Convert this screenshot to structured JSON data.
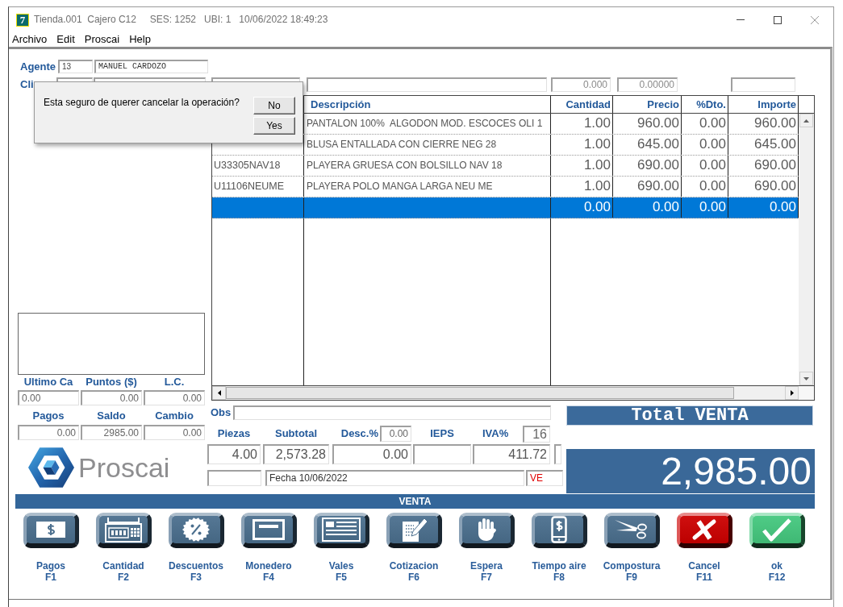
{
  "window": {
    "icon_glyph": "7",
    "title": "Tienda.001  Cajero C12     SES: 1252   UBI: 1   10/06/2022 18:49:23",
    "menu": [
      "Archivo",
      "Edit",
      "Proscai",
      "Help"
    ]
  },
  "agent": {
    "label": "Agente",
    "code": "13",
    "name": "MANUEL CARDOZO"
  },
  "client": {
    "label": "Cli",
    "value_1": "0.000",
    "value_2": "0.00000"
  },
  "table": {
    "columns": [
      "Descripción",
      "Cantidad",
      "Precio",
      "%Dto.",
      "Importe"
    ],
    "rows": [
      {
        "description": "PANTALON 100%  ALGODON MOD. ESCOCES OLI 1",
        "quantity": "1.00",
        "price": "960.00",
        "discount": "0.00",
        "amount": "960.00",
        "selected": false
      },
      {
        "description": "BLUSA ENTALLADA CON CIERRE NEG 28",
        "quantity": "1.00",
        "price": "645.00",
        "discount": "0.00",
        "amount": "645.00",
        "selected": false
      },
      {
        "code": "U33305NAV18",
        "description": "PLAYERA GRUESA CON BOLSILLO NAV 18",
        "quantity": "1.00",
        "price": "690.00",
        "discount": "0.00",
        "amount": "690.00",
        "selected": false
      },
      {
        "code": "U11106NEUME",
        "description": "PLAYERA POLO MANGA LARGA NEU ME",
        "quantity": "1.00",
        "price": "690.00",
        "discount": "0.00",
        "amount": "690.00",
        "selected": false
      },
      {
        "quantity": "0.00",
        "price": "0.00",
        "discount": "0.00",
        "amount": "0.00",
        "selected": true
      }
    ]
  },
  "side_panel": {
    "stats": [
      {
        "label": "Ultimo Ca",
        "value": "0.00"
      },
      {
        "label": "Puntos ($)",
        "value": "0.00"
      },
      {
        "label": "L.C.",
        "value": "0.00"
      }
    ],
    "payments": [
      {
        "label": "Pagos",
        "value": "0.00"
      },
      {
        "label": "Saldo",
        "value": "2985.00"
      },
      {
        "label": "Cambio",
        "value": "0.00"
      }
    ]
  },
  "logo": {
    "text": "Proscai"
  },
  "obs": {
    "label": "Obs"
  },
  "summary": [
    {
      "label": "Piezas",
      "value": "4.00"
    },
    {
      "label": "Subtotal",
      "value": "2,573.28"
    },
    {
      "label": "Desc.%",
      "rate": "0.00",
      "value": "0.00"
    },
    {
      "label": "IEPS"
    },
    {
      "label": "IVA%",
      "rate": "16",
      "value": "411.72"
    }
  ],
  "footer_fields": {
    "date": "Fecha 10/06/2022",
    "code": "VE"
  },
  "total": {
    "label": "Total VENTA",
    "amount": "2,985.00"
  },
  "section_bar": {
    "title": "VENTA"
  },
  "actions": [
    {
      "label": "Pagos",
      "key": "F1",
      "kind": "banknote",
      "color": "#4b6f8e"
    },
    {
      "label": "Cantidad",
      "key": "F2",
      "kind": "register",
      "color": "#4b6f8e"
    },
    {
      "label": "Descuentos",
      "key": "F3",
      "kind": "percent",
      "color": "#4b6f8e"
    },
    {
      "label": "Monedero",
      "key": "F4",
      "kind": "card",
      "color": "#4b6f8e"
    },
    {
      "label": "Vales",
      "key": "F5",
      "kind": "form",
      "color": "#4b6f8e"
    },
    {
      "label": "Cotizacion",
      "key": "F6",
      "kind": "note",
      "color": "#4b6f8e"
    },
    {
      "label": "Espera",
      "key": "F7",
      "kind": "hand",
      "color": "#4b6f8e"
    },
    {
      "label": "Tiempo aire",
      "key": "F8",
      "kind": "phone",
      "color": "#4b6f8e"
    },
    {
      "label": "Compostura",
      "key": "F9",
      "kind": "scissors",
      "color": "#4b6f8e"
    },
    {
      "label": "Cancel",
      "key": "F11",
      "kind": "cross",
      "color": "#cc0000"
    },
    {
      "label": "ok",
      "key": "F12",
      "kind": "check",
      "color": "#44c87e"
    }
  ],
  "dialog": {
    "message": "Esta seguro de querer cancelar la operación?",
    "buttons": [
      "No",
      "Yes"
    ]
  }
}
